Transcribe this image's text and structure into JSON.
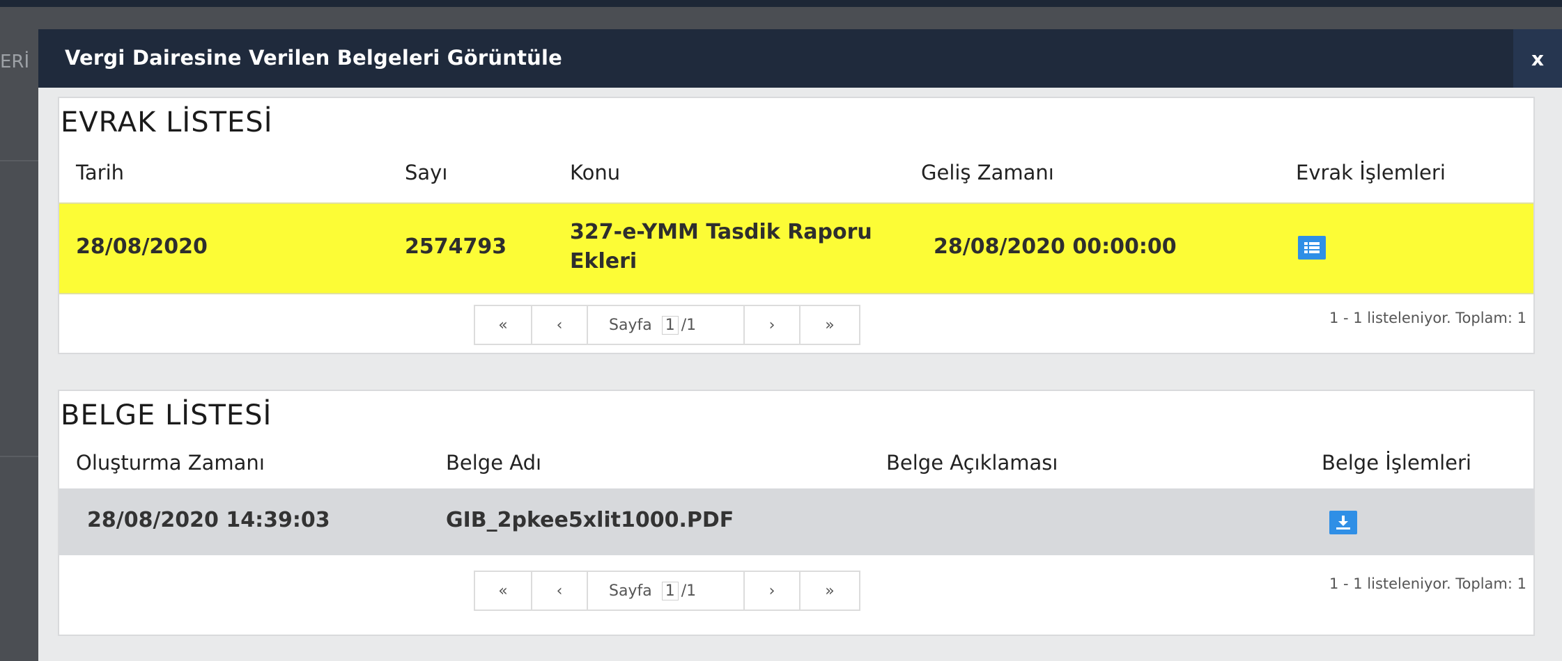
{
  "background": {
    "partial_text": "ERİ"
  },
  "modal": {
    "title": "Vergi Dairesine Verilen Belgeleri Görüntüle",
    "close_label": "x"
  },
  "evrak": {
    "title": "EVRAK LİSTESİ",
    "columns": [
      "Tarih",
      "Sayı",
      "Konu",
      "Geliş Zamanı",
      "Evrak İşlemleri"
    ],
    "rows": [
      {
        "tarih": "28/08/2020",
        "sayi": "2574793",
        "konu": "327-e-YMM Tasdik Raporu Ekleri",
        "gelis_zamani": "28/08/2020 00:00:00",
        "action_icon": "list-icon"
      }
    ],
    "pager": {
      "first": "«",
      "prev": "‹",
      "page_label": "Sayfa",
      "page": "1",
      "total": "/1",
      "next": "›",
      "last": "»"
    },
    "summary": "1 - 1 listeleniyor. Toplam: 1"
  },
  "belge": {
    "title": "BELGE LİSTESİ",
    "columns": [
      "Oluşturma Zamanı",
      "Belge Adı",
      "Belge Açıklaması",
      "Belge İşlemleri"
    ],
    "rows": [
      {
        "olusturma_zamani": "28/08/2020 14:39:03",
        "belge_adi": "GIB_2pkee5xlit1000.PDF",
        "belge_aciklamasi": "",
        "action_icon": "download-icon"
      }
    ],
    "pager": {
      "first": "«",
      "prev": "‹",
      "page_label": "Sayfa",
      "page": "1",
      "total": "/1",
      "next": "›",
      "last": "»"
    },
    "summary": "1 - 1 listeleniyor. Toplam: 1"
  },
  "colors": {
    "header_bg": "#1f2a3c",
    "highlight_row": "#fcfc36",
    "selected_row": "#d7d9dc",
    "action_button": "#2f8fe6"
  }
}
